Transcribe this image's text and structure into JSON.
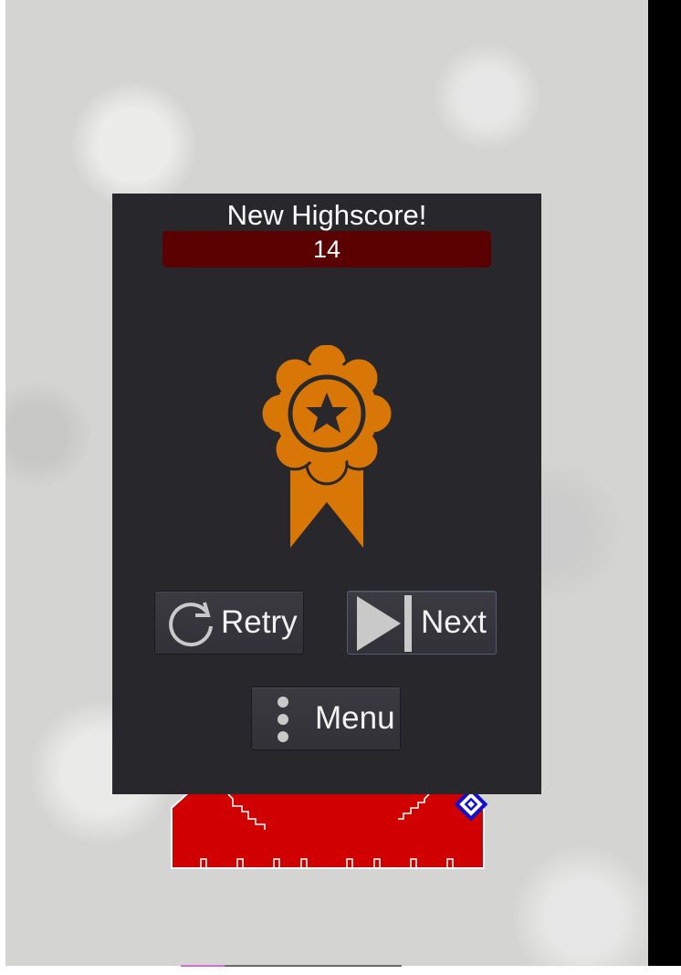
{
  "dialog": {
    "title": "New Highscore!",
    "score": "14"
  },
  "buttons": {
    "retry_label": "Retry",
    "next_label": "Next",
    "menu_label": "Menu"
  },
  "icons": {
    "medal": "award-ribbon-icon",
    "retry": "refresh-icon",
    "next": "skip-next-icon",
    "menu": "vertical-dots-icon"
  },
  "colors": {
    "medal": "#d97706",
    "score_bar": "#5a0000",
    "dialog_bg": "#28272c",
    "game_block": "#d00000"
  }
}
